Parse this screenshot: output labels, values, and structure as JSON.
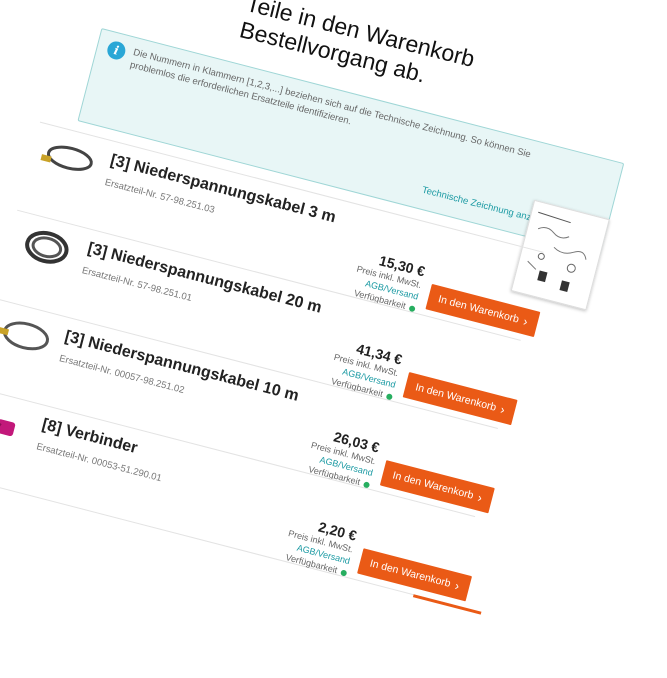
{
  "heading": {
    "line1": "Teile in den Warenkorb",
    "line2": "Bestellvorgang ab."
  },
  "info": {
    "text": "Die Nummern in Klammern [1,2,3,...] beziehen sich auf die Technische Zeichnung. So können Sie problemlos die erforderlichen Ersatzteile identifizieren.",
    "link_label": "Technische Zeichnung anzeigen",
    "icon": "info-icon"
  },
  "price_label": "Preis inkl. MwSt.",
  "agb_label": "AGB/Versand",
  "availability_label": "Verfügbarkeit",
  "cart_label": "In den Warenkorb",
  "items": [
    {
      "title": "[3] Niederspannungskabel 3 m",
      "partno": "Ersatzteil-Nr. 57-98.251.03",
      "price": "15,30 €"
    },
    {
      "title": "[3] Niederspannungskabel 20 m",
      "partno": "Ersatzteil-Nr. 57-98.251.01",
      "price": "41,34 €"
    },
    {
      "title": "[3] Niederspannungskabel 10 m",
      "partno": "Ersatzteil-Nr. 00057-98.251.02",
      "price": "26,03 €"
    },
    {
      "title": "[8] Verbinder",
      "partno": "Ersatzteil-Nr. 00053-51.290.01",
      "price": "2,20 €"
    }
  ],
  "colors": {
    "accent": "#ea5a16",
    "link": "#1b9aa3",
    "info_bg": "#e8f6f6",
    "available": "#27ae60"
  }
}
